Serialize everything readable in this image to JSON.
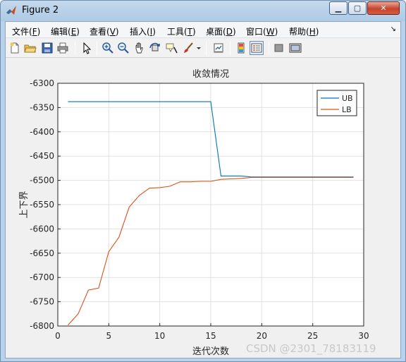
{
  "window": {
    "title": "Figure 2",
    "buttons": {
      "minimize": "▁",
      "maximize": "▢",
      "close": "✕"
    }
  },
  "menu": [
    {
      "text": "文件(",
      "key": "F",
      "end": ")"
    },
    {
      "text": "编辑(",
      "key": "E",
      "end": ")"
    },
    {
      "text": "查看(",
      "key": "V",
      "end": ")"
    },
    {
      "text": "插入(",
      "key": "I",
      "end": ")"
    },
    {
      "text": "工具(",
      "key": "T",
      "end": ")"
    },
    {
      "text": "桌面(",
      "key": "D",
      "end": ")"
    },
    {
      "text": "窗口(",
      "key": "W",
      "end": ")"
    },
    {
      "text": "帮助(",
      "key": "H",
      "end": ")"
    }
  ],
  "toolbar_icons": [
    "new-figure-icon",
    "open-file-icon",
    "save-icon",
    "print-icon",
    "pointer-icon",
    "zoom-in-icon",
    "zoom-out-icon",
    "pan-icon",
    "rotate-3d-icon",
    "data-cursor-icon",
    "brush-icon",
    "brush-dropdown-icon",
    "link-plot-icon",
    "colorbar-icon",
    "legend-icon",
    "hide-plot-tools-icon",
    "show-plot-tools-icon"
  ],
  "chart_data": {
    "type": "line",
    "title": "收敛情况",
    "xlabel": "迭代次数",
    "ylabel": "上下界",
    "xlim": [
      0,
      30
    ],
    "ylim": [
      -6800,
      -6300
    ],
    "xticks": [
      0,
      5,
      10,
      15,
      20,
      25,
      30
    ],
    "yticks": [
      -6300,
      -6350,
      -6400,
      -6450,
      -6500,
      -6550,
      -6600,
      -6650,
      -6700,
      -6750,
      -6800
    ],
    "grid": true,
    "legend_position": "top-right",
    "series": [
      {
        "name": "UB",
        "color": "#0072bd",
        "x": [
          1,
          2,
          3,
          4,
          5,
          6,
          7,
          8,
          9,
          10,
          11,
          12,
          13,
          14,
          15,
          16,
          17,
          18,
          19,
          20,
          21,
          22,
          23,
          24,
          25,
          26,
          27,
          28,
          29
        ],
        "y": [
          -6338,
          -6338,
          -6338,
          -6338,
          -6338,
          -6338,
          -6338,
          -6338,
          -6338,
          -6338,
          -6338,
          -6338,
          -6338,
          -6338,
          -6338,
          -6491,
          -6491,
          -6491,
          -6493,
          -6493,
          -6493,
          -6493,
          -6493,
          -6493,
          -6493,
          -6493,
          -6493,
          -6493,
          -6493
        ]
      },
      {
        "name": "LB",
        "color": "#d95319",
        "x": [
          1,
          2,
          3,
          4,
          5,
          6,
          7,
          8,
          9,
          10,
          11,
          12,
          13,
          14,
          15,
          16,
          17,
          18,
          19,
          20,
          21,
          22,
          23,
          24,
          25,
          26,
          27,
          28,
          29
        ],
        "y": [
          -6798,
          -6775,
          -6726,
          -6722,
          -6647,
          -6617,
          -6555,
          -6531,
          -6516,
          -6515,
          -6512,
          -6503,
          -6503,
          -6502,
          -6502,
          -6498,
          -6497,
          -6496,
          -6494,
          -6494,
          -6494,
          -6494,
          -6494,
          -6494,
          -6494,
          -6494,
          -6494,
          -6494,
          -6494
        ]
      }
    ]
  },
  "watermark": "CSDN @2301_78183119"
}
